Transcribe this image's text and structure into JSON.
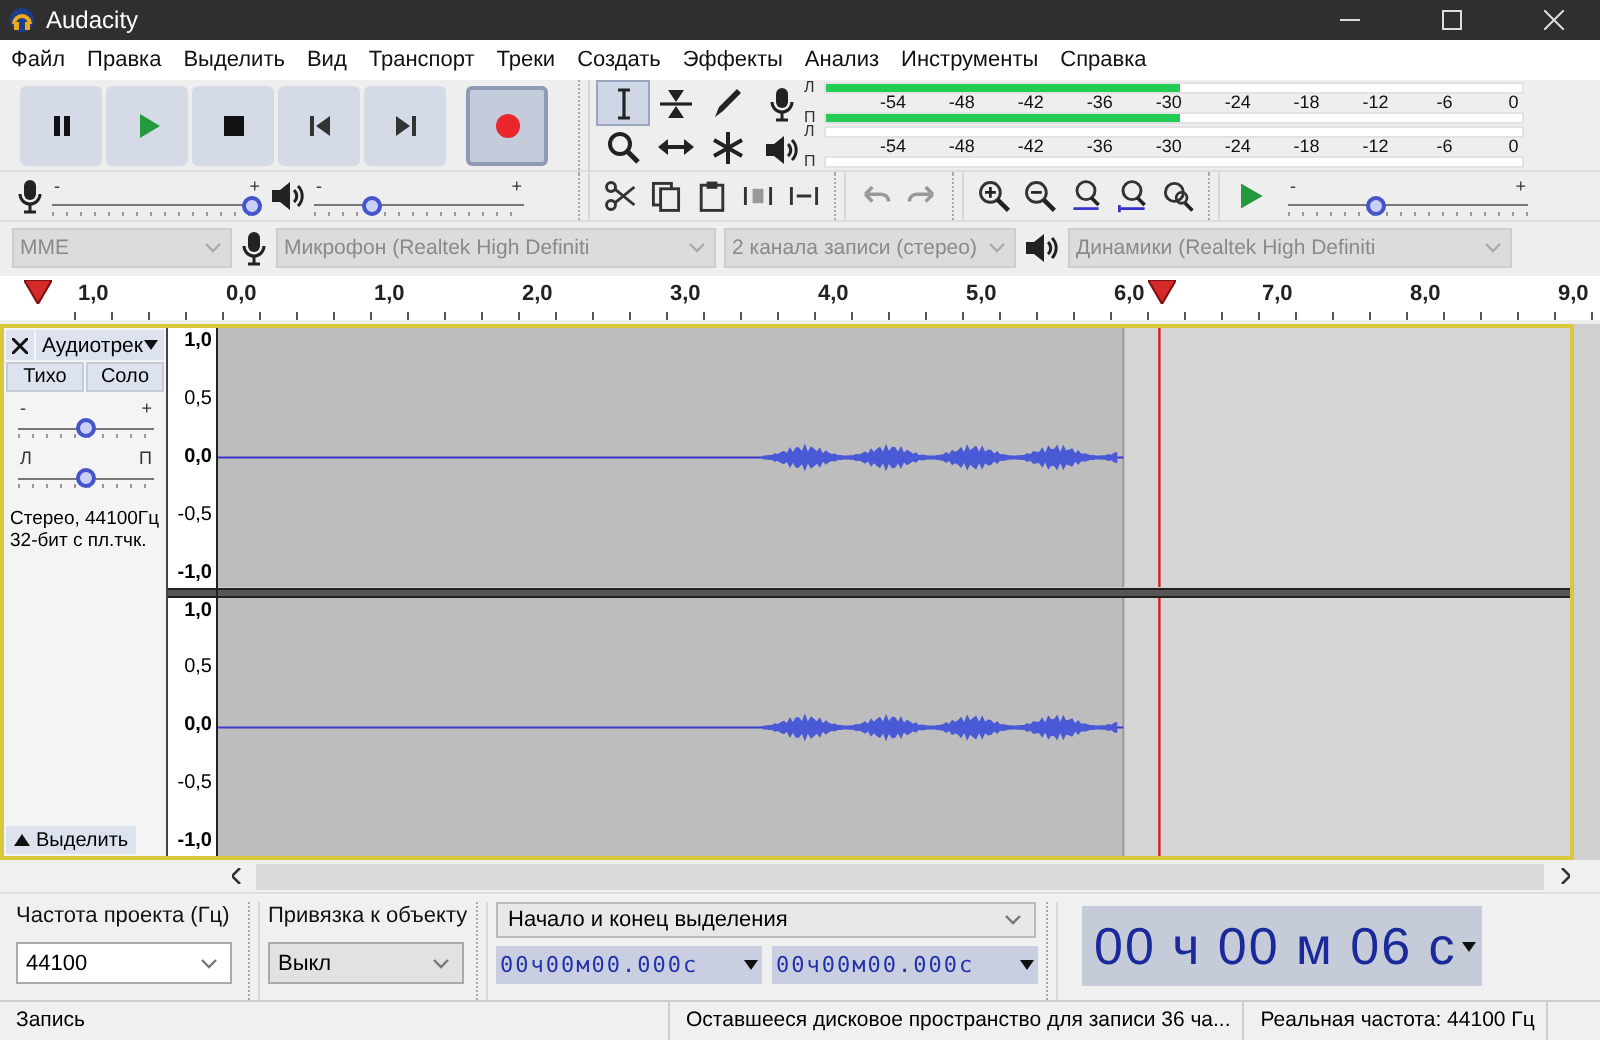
{
  "window": {
    "title": "Audacity"
  },
  "menu": [
    "Файл",
    "Правка",
    "Выделить",
    "Вид",
    "Транспорт",
    "Треки",
    "Создать",
    "Эффекты",
    "Анализ",
    "Инструменты",
    "Справка"
  ],
  "transport": [
    {
      "kind": "pause",
      "pressed": false
    },
    {
      "kind": "play",
      "pressed": false
    },
    {
      "kind": "stop",
      "pressed": false
    },
    {
      "kind": "skip_start",
      "pressed": false
    },
    {
      "kind": "skip_end",
      "pressed": false
    },
    {
      "kind": "record",
      "pressed": true
    }
  ],
  "tools": [
    {
      "kind": "select",
      "selected": true
    },
    {
      "kind": "envelope",
      "selected": false
    },
    {
      "kind": "draw",
      "selected": false
    },
    {
      "kind": "zoom",
      "selected": false
    },
    {
      "kind": "time_shift",
      "selected": false
    },
    {
      "kind": "multi",
      "selected": false
    }
  ],
  "meters": [
    {
      "kind": "recording",
      "ticks": [
        "-54",
        "-48",
        "-42",
        "-36",
        "-30",
        "-24",
        "-18",
        "-12",
        "-6",
        "0"
      ],
      "channels": [
        {
          "label": "Л",
          "level": 0.51
        },
        {
          "label": "П",
          "level": 0.51
        }
      ]
    },
    {
      "kind": "playback",
      "ticks": [
        "-54",
        "-48",
        "-42",
        "-36",
        "-30",
        "-24",
        "-18",
        "-12",
        "-6",
        "0"
      ],
      "channels": [
        {
          "label": "Л"
        },
        {
          "label": "П"
        }
      ]
    }
  ],
  "mixer": [
    {
      "kind": "recording",
      "min_label": "-",
      "max_label": "+",
      "level": 1
    },
    {
      "kind": "playback",
      "min_label": "-",
      "max_label": "+",
      "level": 0.25
    }
  ],
  "play_at_speed": {
    "min_label": "-",
    "max_label": "+",
    "level": 0.35
  },
  "devices": {
    "host": "MME",
    "recording_device": "Микрофон (Realtek High Definiti",
    "channels": "2 канала записи (стерео)",
    "playback_device": "Динамики (Realtek High Definiti"
  },
  "timeline": {
    "labels": [
      "1,0",
      "0,0",
      "1,0",
      "2,0",
      "3,0",
      "4,0",
      "5,0",
      "6,0",
      "7,0",
      "8,0",
      "9,0"
    ]
  },
  "track": {
    "name": "Аудиотрек",
    "selected": true,
    "mute": {
      "label": "Тихо",
      "on": false
    },
    "solo": {
      "label": "Соло",
      "on": false
    },
    "gain": {
      "min_label": "-",
      "max_label": "+",
      "level": 0.5
    },
    "pan": {
      "min_label": "Л",
      "max_label": "П",
      "level": 0.5
    },
    "info": [
      "Стерео, 44100Гц",
      "32-бит с пл.тчк."
    ],
    "select_label": "Выделить",
    "channels": [
      {
        "scale": [
          "1,0",
          "0,5",
          "0,0",
          "-0,5",
          "-1,0"
        ]
      },
      {
        "scale": [
          "1,0",
          "0,5",
          "0,0",
          "-0,5",
          "-1,0"
        ]
      }
    ]
  },
  "selection_toolbar": {
    "project_rate": {
      "label": "Частота проекта (Гц)",
      "value": "44100"
    },
    "snap": {
      "label": "Привязка к объекту",
      "value": "Выкл"
    },
    "selection_mode": "Начало и конец выделения",
    "selection_start": "00ч00м00.000с",
    "selection_end": "00ч00м00.000с",
    "position": "00 ч 00 м 06 с"
  },
  "status_bar": [
    "Запись",
    "Оставшееся дисковое пространство для записи 36 ча...",
    "Реальная частота: 44100 Гц"
  ]
}
